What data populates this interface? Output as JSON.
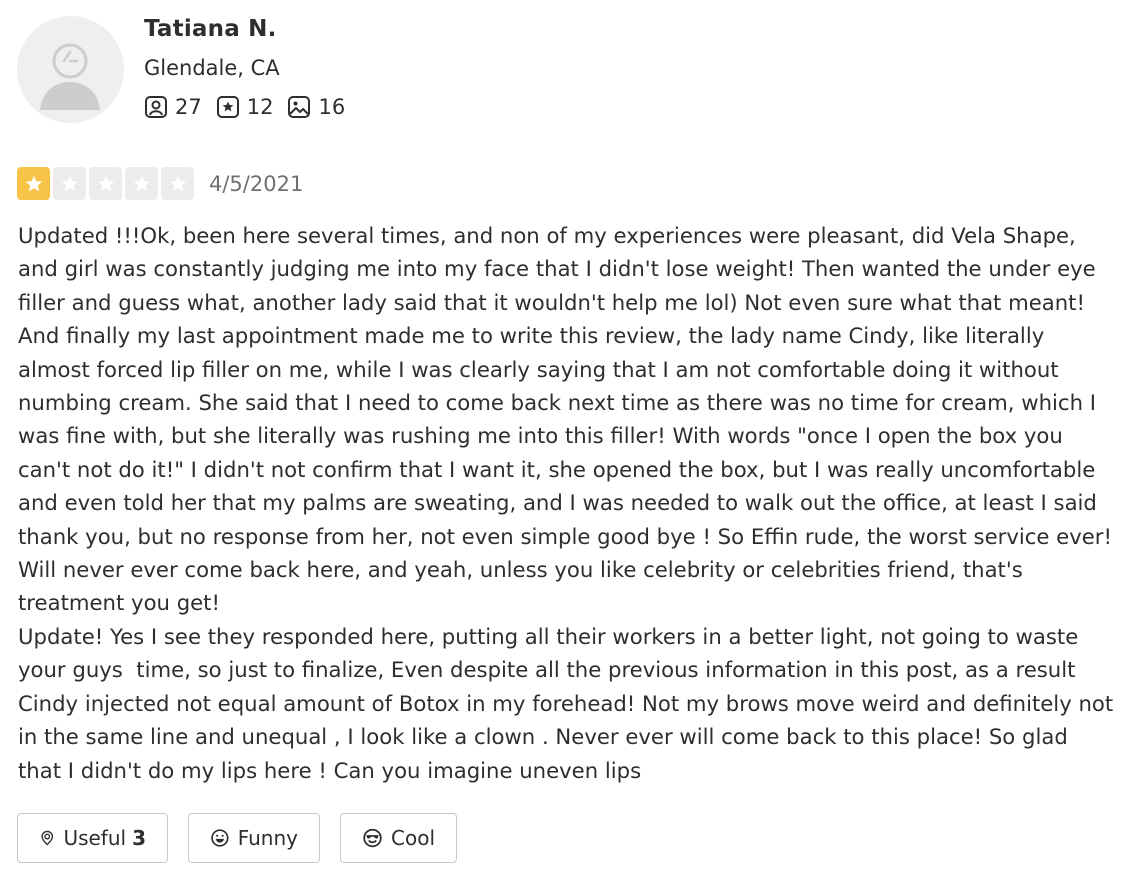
{
  "user": {
    "name": "Tatiana N.",
    "location": "Glendale, CA",
    "stats": {
      "friends": "27",
      "reviews": "12",
      "photos": "16"
    }
  },
  "review": {
    "rating": 1,
    "max_rating": 5,
    "date": "4/5/2021",
    "text": "Updated !!!Ok, been here several times, and non of my experiences were pleasant, did Vela Shape, and girl was constantly judging me into my face that I didn't lose weight! Then wanted the under eye filler and guess what, another lady said that it wouldn't help me lol) Not even sure what that meant! And finally my last appointment made me to write this review, the lady name Cindy, like literally almost forced lip filler on me, while I was clearly saying that I am not comfortable doing it without numbing cream. She said that I need to come back next time as there was no time for cream, which I was fine with, but she literally was rushing me into this filler! With words \"once I open the box you can't not do it!\" I didn't not confirm that I want it, she opened the box, but I was really uncomfortable and even told her that my palms are sweating, and I was needed to walk out the office, at least I said thank you, but no response from her, not even simple good bye ! So Effin rude, the worst service ever! Will never ever come back here, and yeah, unless you like celebrity or celebrities friend, that's treatment you get!\nUpdate! Yes I see they responded here, putting all their workers in a better light, not going to waste your guys  time, so just to finalize, Even despite all the previous information in this post, as a result Cindy injected not equal amount of Botox in my forehead! Not my brows move weird and definitely not in the same line and unequal , I look like a clown . Never ever will come back to this place! So glad that I didn't do my lips here ! Can you imagine uneven lips"
  },
  "reactions": {
    "useful_label": "Useful",
    "useful_count": "3",
    "funny_label": "Funny",
    "cool_label": "Cool"
  },
  "colors": {
    "star_on": "#f7c447",
    "star_off": "#ececec",
    "text": "#2d2e2f",
    "muted": "#6e7072",
    "border": "#c8c9ca"
  },
  "icons": {
    "friends": "friends-icon",
    "reviews": "review-star-icon",
    "photos": "photo-icon",
    "useful": "useful-icon",
    "funny": "funny-icon",
    "cool": "cool-icon"
  }
}
